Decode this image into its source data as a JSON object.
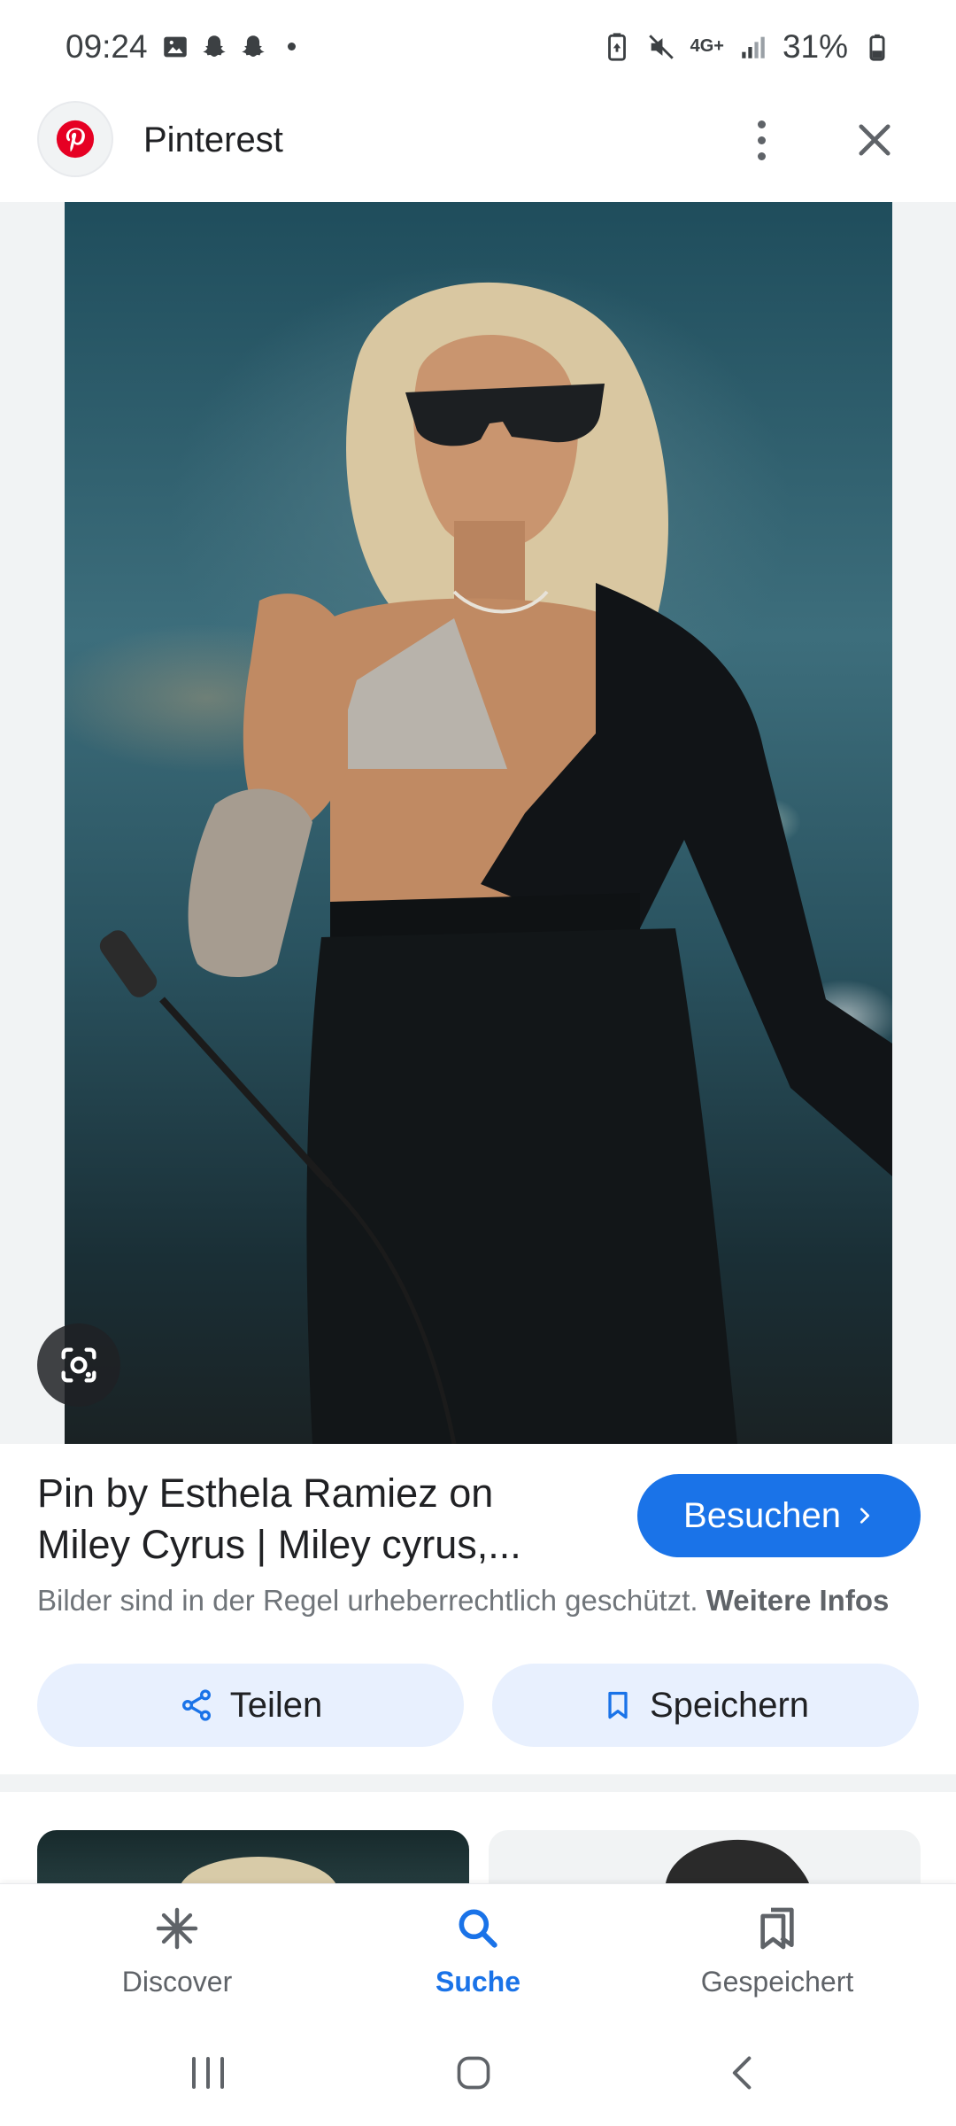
{
  "status_bar": {
    "time": "09:24",
    "battery": "31%",
    "network": "4G+",
    "left_icons": [
      "image-icon",
      "snapchat-icon",
      "snapchat-icon"
    ],
    "right_icons": [
      "battery-saver-icon",
      "mute-icon",
      "network-icon",
      "signal-icon",
      "battery-icon"
    ]
  },
  "header": {
    "app_name": "Pinterest",
    "logo_icon": "pinterest-logo-icon",
    "brand_color": "#e60023"
  },
  "result": {
    "title": "Pin by Esthela Ramiez on Miley Cyrus | Miley cyrus,...",
    "visit_label": "Besuchen",
    "copyright_text": "Bilder sind in der Regel urheberrechtlich geschützt.",
    "copyright_more": "Weitere Infos",
    "share_label": "Teilen",
    "save_label": "Speichern",
    "accent_color": "#1a73e8"
  },
  "bottom_nav": {
    "items": [
      {
        "label": "Discover",
        "icon": "asterisk-icon",
        "active": false
      },
      {
        "label": "Suche",
        "icon": "search-icon",
        "active": true
      },
      {
        "label": "Gespeichert",
        "icon": "bookmarks-icon",
        "active": false
      }
    ]
  }
}
